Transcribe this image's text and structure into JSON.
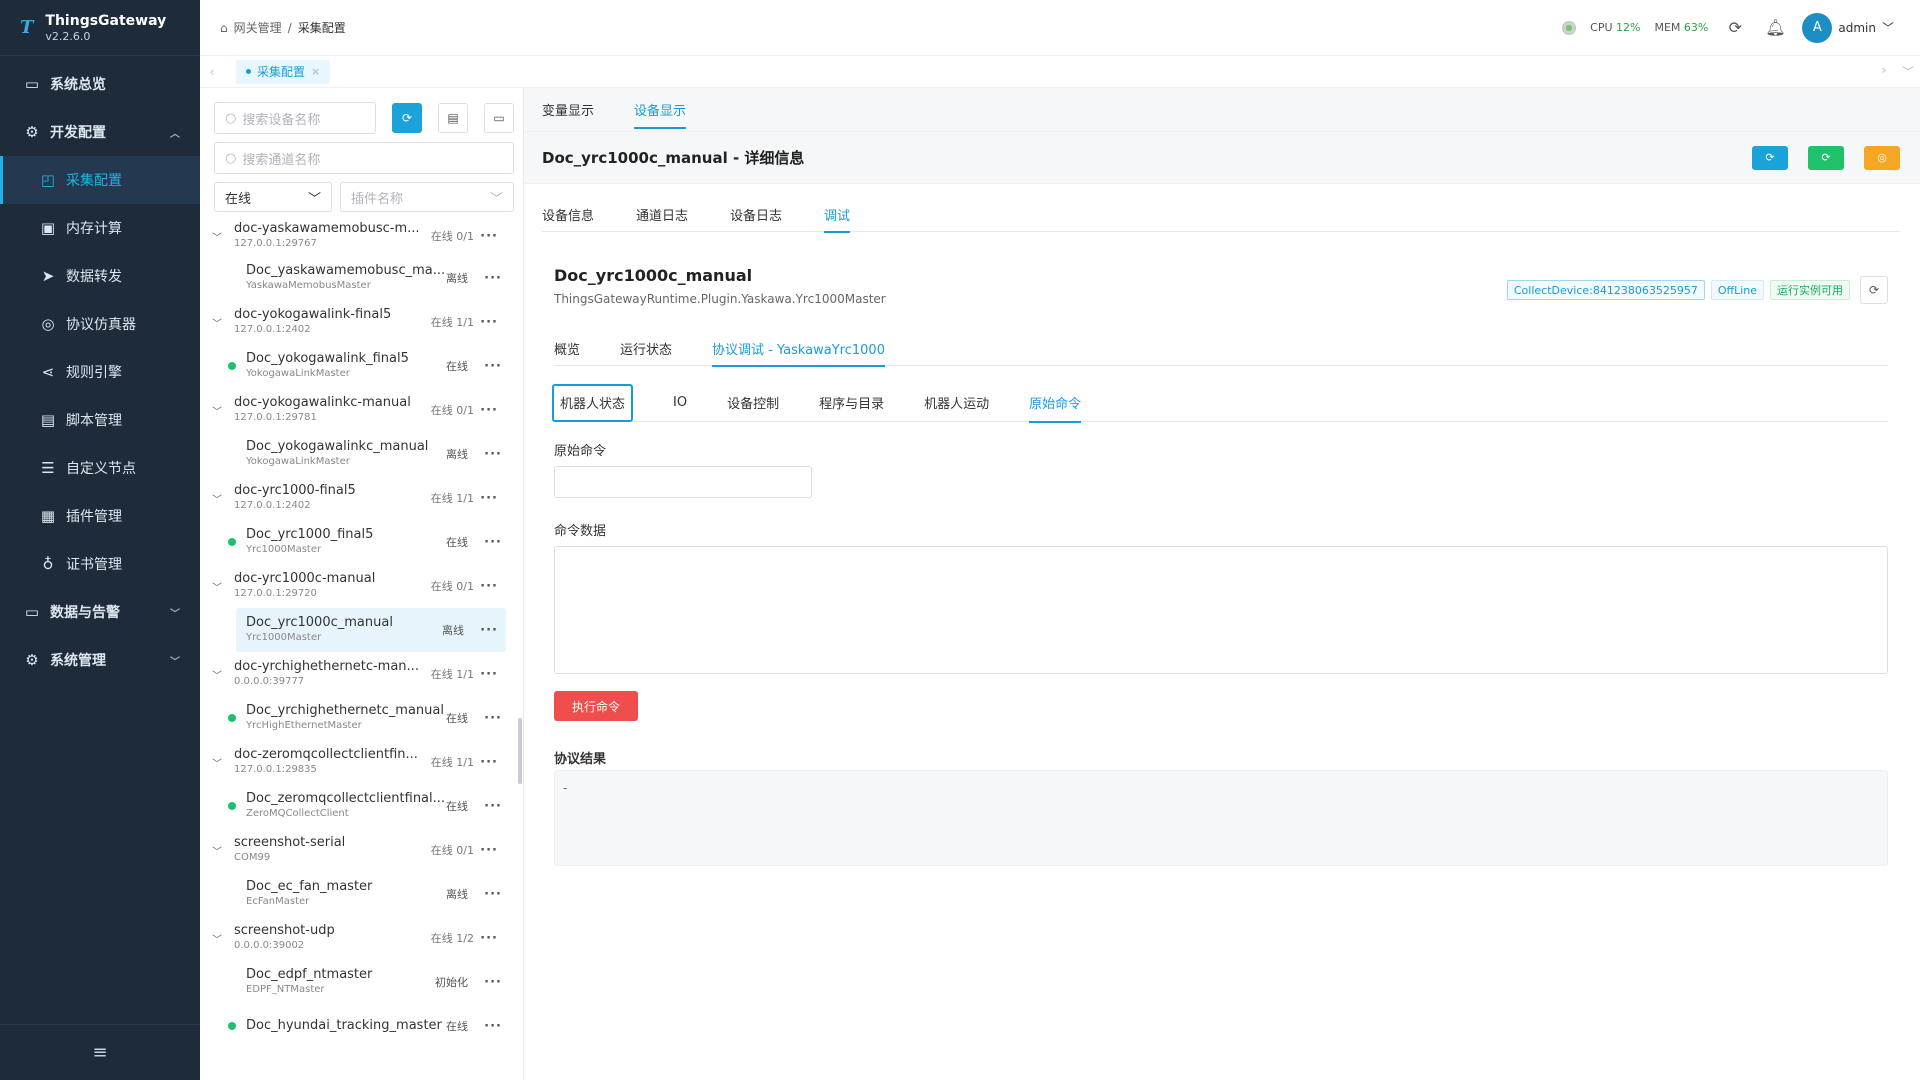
{
  "brand": {
    "name": "ThingsGateway",
    "version": "v2.2.6.0",
    "logo": "T"
  },
  "sidebar": {
    "items": [
      {
        "label": "系统总览",
        "icon": "monitor-icon"
      },
      {
        "label": "开发配置",
        "icon": "gear-icon"
      },
      {
        "label": "采集配置",
        "icon": "chart-icon"
      },
      {
        "label": "内存计算",
        "icon": "chip-icon"
      },
      {
        "label": "数据转发",
        "icon": "send-icon"
      },
      {
        "label": "协议仿真器",
        "icon": "simulator-icon"
      },
      {
        "label": "规则引擎",
        "icon": "share-icon"
      },
      {
        "label": "脚本管理",
        "icon": "script-icon"
      },
      {
        "label": "自定义节点",
        "icon": "sliders-icon"
      },
      {
        "label": "插件管理",
        "icon": "plugin-icon"
      },
      {
        "label": "证书管理",
        "icon": "certificate-icon"
      },
      {
        "label": "数据与告警",
        "icon": "alarm-icon"
      },
      {
        "label": "系统管理",
        "icon": "settings-icon"
      }
    ]
  },
  "header": {
    "breadcrumb_root": "网关管理",
    "breadcrumb_sep": "/",
    "breadcrumb_current": "采集配置",
    "cpu_label": "CPU",
    "cpu_value": "12%",
    "mem_label": "MEM",
    "mem_value": "63%",
    "avatar_letter": "A",
    "username": "admin"
  },
  "tabbar": {
    "tab_label": "采集配置",
    "close": "×"
  },
  "devpanel": {
    "search_device_placeholder": "搜索设备名称",
    "search_channel_placeholder": "搜索通道名称",
    "status_filter": "在线",
    "plugin_placeholder": "插件名称",
    "groups": [
      {
        "name": "doc-yaskawamemobusc-m...",
        "addr": "127.0.0.1:29767",
        "stat": "在线 0/1",
        "device": {
          "name": "Doc_yaskawamemobusc_ma...",
          "plugin": "YaskawaMemobusMaster",
          "stat": "离线",
          "online": false
        }
      },
      {
        "name": "doc-yokogawalink-final5",
        "addr": "127.0.0.1:2402",
        "stat": "在线 1/1",
        "device": {
          "name": "Doc_yokogawalink_final5",
          "plugin": "YokogawaLinkMaster",
          "stat": "在线",
          "online": true
        }
      },
      {
        "name": "doc-yokogawalinkc-manual",
        "addr": "127.0.0.1:29781",
        "stat": "在线 0/1",
        "device": {
          "name": "Doc_yokogawalinkc_manual",
          "plugin": "YokogawaLinkMaster",
          "stat": "离线",
          "online": false
        }
      },
      {
        "name": "doc-yrc1000-final5",
        "addr": "127.0.0.1:2402",
        "stat": "在线 1/1",
        "device": {
          "name": "Doc_yrc1000_final5",
          "plugin": "Yrc1000Master",
          "stat": "在线",
          "online": true
        }
      },
      {
        "name": "doc-yrc1000c-manual",
        "addr": "127.0.0.1:29720",
        "stat": "在线 0/1",
        "device": {
          "name": "Doc_yrc1000c_manual",
          "plugin": "Yrc1000Master",
          "stat": "离线",
          "online": false,
          "selected": true
        }
      },
      {
        "name": "doc-yrchighethernetc-man...",
        "addr": "0.0.0.0:39777",
        "stat": "在线 1/1",
        "device": {
          "name": "Doc_yrchighethernetc_manual",
          "plugin": "YrcHighEthernetMaster",
          "stat": "在线",
          "online": true
        }
      },
      {
        "name": "doc-zeromqcollectclientfin...",
        "addr": "127.0.0.1:29835",
        "stat": "在线 1/1",
        "device": {
          "name": "Doc_zeromqcollectclientfinal...",
          "plugin": "ZeroMQCollectClient",
          "stat": "在线",
          "online": true
        }
      },
      {
        "name": "screenshot-serial",
        "addr": "COM99",
        "stat": "在线 0/1",
        "device": {
          "name": "Doc_ec_fan_master",
          "plugin": "EcFanMaster",
          "stat": "离线",
          "online": false
        }
      },
      {
        "name": "screenshot-udp",
        "addr": "0.0.0.0:39002",
        "stat": "在线 1/2",
        "device": {
          "name": "Doc_edpf_ntmaster",
          "plugin": "EDPF_NTMaster",
          "stat": "初始化",
          "online": false
        },
        "device2": {
          "name": "Doc_hyundai_tracking_master",
          "stat": "在线",
          "online": true
        }
      }
    ]
  },
  "main": {
    "top_tabs": [
      "变量显示",
      "设备显示"
    ],
    "detail_title": "Doc_yrc1000c_manual - 详细信息",
    "sub_tabs": [
      "设备信息",
      "通道日志",
      "设备日志",
      "调试"
    ],
    "device_name": "Doc_yrc1000c_manual",
    "device_class": "ThingsGatewayRuntime.Plugin.Yaskawa.Yrc1000Master",
    "badge_id": "CollectDevice:841238063525957",
    "badge_state": "OffLine",
    "badge_runtime": "运行实例可用",
    "debug_tabs": [
      "概览",
      "运行状态",
      "协议调试 - YaskawaYrc1000"
    ],
    "proto_tabs": [
      "机器人状态",
      "IO",
      "设备控制",
      "程序与目录",
      "机器人运动",
      "原始命令"
    ],
    "raw_cmd_label": "原始命令",
    "raw_cmd_value": "",
    "cmd_data_label": "命令数据",
    "cmd_data_value": "",
    "exec_label": "执行命令",
    "result_label": "协议结果",
    "result_value": "-"
  }
}
